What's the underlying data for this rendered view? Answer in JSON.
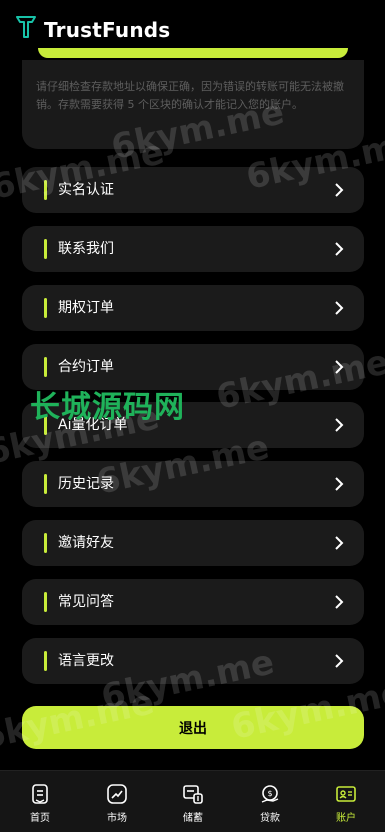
{
  "header": {
    "title": "TrustFunds",
    "logo_icon": "trustfunds-logo-icon"
  },
  "notice": {
    "text": "请仔细检查存款地址以确保正确，因为错误的转账可能无法被撤销。存款需要获得 5 个区块的确认才能记入您的账户。"
  },
  "menu": {
    "items": [
      {
        "label": "实名认证"
      },
      {
        "label": "联系我们"
      },
      {
        "label": "期权订单"
      },
      {
        "label": "合约订单"
      },
      {
        "label": "Ai量化订单"
      },
      {
        "label": "历史记录"
      },
      {
        "label": "邀请好友"
      },
      {
        "label": "常见问答"
      },
      {
        "label": "语言更改"
      }
    ],
    "chevron_icon": "chevron-right-icon"
  },
  "logout": {
    "label": "退出"
  },
  "tabs": [
    {
      "label": "首页",
      "icon": "home-icon"
    },
    {
      "label": "市场",
      "icon": "market-icon"
    },
    {
      "label": "储蓄",
      "icon": "savings-icon"
    },
    {
      "label": "贷款",
      "icon": "loan-icon"
    },
    {
      "label": "账户",
      "icon": "account-icon",
      "active": true
    }
  ],
  "watermarks": {
    "site": "6kym.me",
    "brand": "长城源码网"
  },
  "colors": {
    "accent": "#c8ec3a",
    "background": "#000000",
    "card": "#1b1b1b",
    "brand_watermark": "#1fb25a"
  }
}
